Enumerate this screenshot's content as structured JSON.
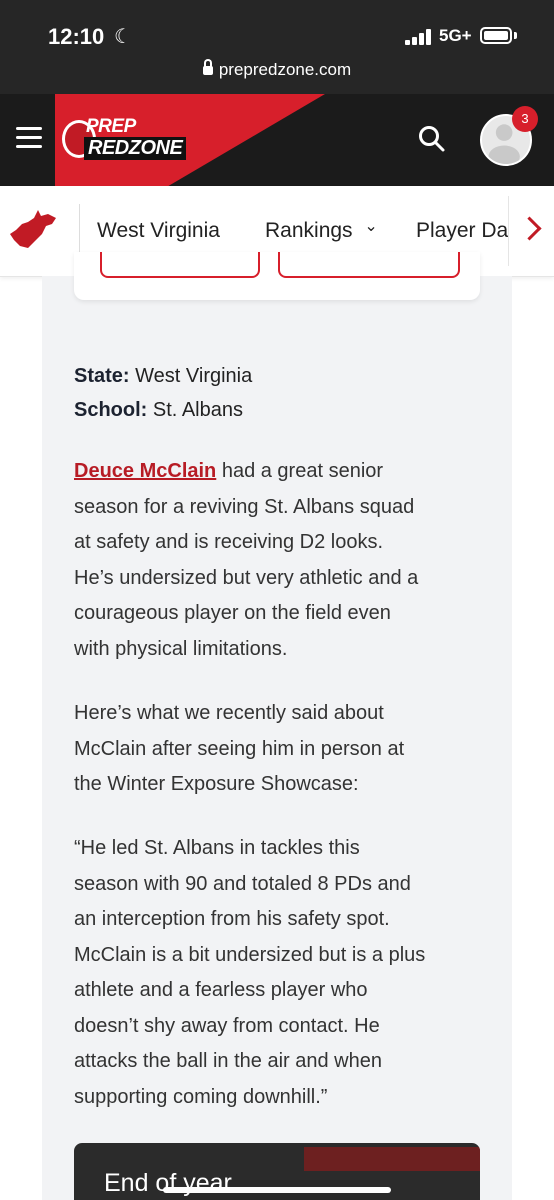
{
  "status_bar": {
    "time": "12:10",
    "network": "5G+",
    "url": "prepredzone.com"
  },
  "header": {
    "logo_line1": "PREP",
    "logo_line2": "REDZONE",
    "notification_count": "3"
  },
  "subnav": {
    "items": [
      {
        "label": "West Virginia"
      },
      {
        "label": "Rankings",
        "chevron": "⌄"
      },
      {
        "label": "Player Da"
      }
    ]
  },
  "article": {
    "state_label": "State:",
    "state_value": "West Virginia",
    "school_label": "School:",
    "school_value": "St. Albans",
    "player_link": "Deuce McClain",
    "para1_rest_line1": " had a great senior",
    "para1_lines": [
      "season for a reviving St. Albans squad",
      "at safety and is receiving D2 looks.",
      "He’s undersized but very athletic and a",
      "courageous player on the field even",
      "with physical limitations."
    ],
    "para2_lines": [
      "Here’s what we recently said about",
      "McClain after seeing him in person at",
      "the Winter Exposure Showcase:"
    ],
    "para3_lines": [
      "“He led St. Albans in tackles this",
      "season with 90 and totaled 8 PDs and",
      "an interception from his safety spot.",
      "McClain is a bit undersized but is a plus",
      "athlete and a fearless player who",
      "doesn’t shy away from contact. He",
      "attacks the ball in the air and when",
      "supporting coming downhill.”"
    ],
    "video_title": "End of year"
  },
  "colors": {
    "brand_red": "#d71f2b",
    "header_dark": "#1b1b1b",
    "link_red": "#b71c25"
  }
}
